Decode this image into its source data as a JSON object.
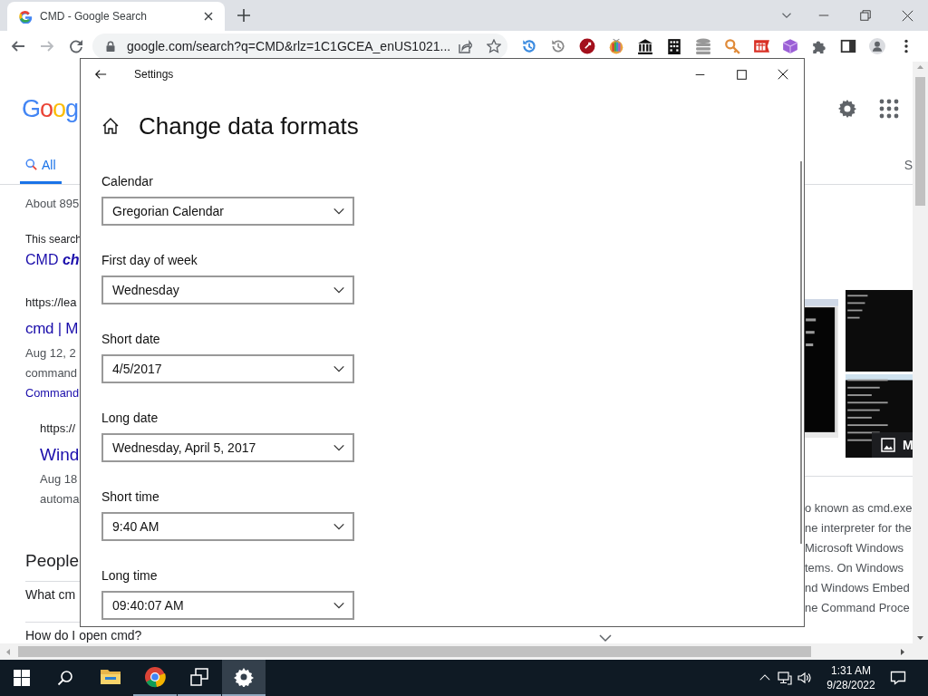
{
  "browser": {
    "tabs": [
      {
        "title": "CMD - Google Search",
        "selected": true
      }
    ],
    "address": "google.com/search?q=CMD&rlz=1C1GCEA_enUS1021..."
  },
  "page": {
    "logo": "Goog",
    "search_tabs": [
      {
        "label": "All",
        "selected": true
      },
      {
        "label": "S",
        "selected": false
      }
    ],
    "result_stats": "About 895",
    "spelling": {
      "note": "This search",
      "link": "CMD **ch**"
    },
    "results": [
      {
        "kind": "main",
        "url": "https://lea",
        "title": "cmd | M",
        "snippet": [
          "Aug 12, 2",
          "command"
        ],
        "link": "Command"
      },
      {
        "kind": "sub",
        "url": "https://",
        "title": "Wind",
        "snippet": [
          "Aug 18",
          "automa"
        ]
      }
    ],
    "people_also_ask": {
      "heading": "People",
      "questions": [
        "What cm",
        "How do I open cmd?"
      ]
    },
    "knowledge_panel": {
      "image_label": "M",
      "description": [
        "o known as cmd.exe",
        "ne interpreter for the",
        "Microsoft Windows",
        "tems. On Windows",
        "nd Windows Embed",
        "ne Command Proce"
      ]
    }
  },
  "settings": {
    "title": "Settings",
    "heading": "Change data formats",
    "fields": [
      {
        "label": "Calendar",
        "value": "Gregorian Calendar"
      },
      {
        "label": "First day of week",
        "value": "Wednesday"
      },
      {
        "label": "Short date",
        "value": "4/5/2017"
      },
      {
        "label": "Long date",
        "value": "Wednesday, April 5, 2017"
      },
      {
        "label": "Short time",
        "value": "9:40 AM"
      },
      {
        "label": "Long time",
        "value": "09:40:07 AM"
      }
    ]
  },
  "taskbar": {
    "apps": [
      {
        "kind": "folder",
        "running": false,
        "active": false
      },
      {
        "kind": "browser",
        "running": true,
        "active": false
      },
      {
        "kind": "task-view",
        "running": true,
        "active": false
      },
      {
        "kind": "settings",
        "running": true,
        "active": true
      }
    ],
    "time": "1:31 AM",
    "date": "9/28/2022"
  }
}
